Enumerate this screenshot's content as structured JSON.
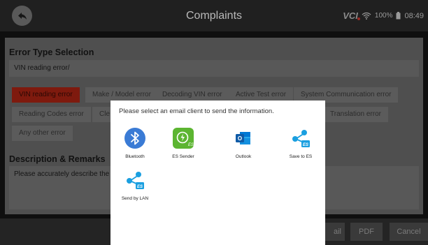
{
  "header": {
    "title": "Complaints"
  },
  "status": {
    "vci": "VCI",
    "battery": "100%",
    "time": "08:49"
  },
  "error_type": {
    "title": "Error Type Selection",
    "selected_value": "VIN reading error/",
    "chips": [
      {
        "label": "VIN reading error",
        "active": true
      },
      {
        "label": "Make / Model error"
      },
      {
        "label": "Decoding VIN error"
      },
      {
        "label": "Active Test error"
      },
      {
        "label": "System Communication error"
      },
      {
        "label": "Reading Codes error"
      },
      {
        "label": "Cle"
      },
      {
        "label": "Translation error"
      },
      {
        "label": "Any other error"
      }
    ]
  },
  "description": {
    "title": "Description & Remarks",
    "placeholder": "Please accurately describe the"
  },
  "bottom": {
    "email": "ail",
    "pdf": "PDF",
    "cancel": "Cancel"
  },
  "modal": {
    "message": "Please select an email client to send the information.",
    "apps": [
      {
        "label": "Bluetooth",
        "icon": "bluetooth-icon"
      },
      {
        "label": "ES Sender",
        "icon": "es-sender-icon"
      },
      {
        "label": "Outlook",
        "icon": "outlook-icon"
      },
      {
        "label": "Save to ES",
        "icon": "share-es-icon"
      },
      {
        "label": "Send by LAN",
        "icon": "share-lan-icon"
      }
    ]
  },
  "colors": {
    "accent_red": "#c8352a",
    "bluetooth_blue": "#3a7bd5",
    "es_green": "#5cb531",
    "outlook_blue": "#0f6fc6",
    "share_blue": "#1a9fe0"
  }
}
